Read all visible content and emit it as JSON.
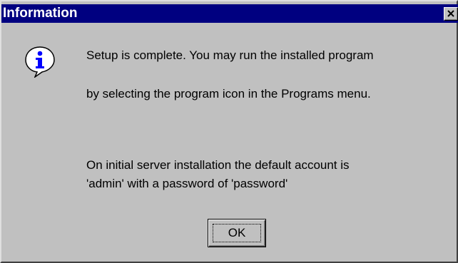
{
  "dialog": {
    "title": "Information",
    "close_glyph": "×",
    "icon": "information-icon",
    "messages": [
      "Setup is complete.  You may run the installed program",
      "by selecting the program icon in the Programs menu.",
      "On initial server installation the default account is",
      "'admin' with a password of 'password'"
    ],
    "ok_label": "OK"
  },
  "colors": {
    "titlebar": "#000080",
    "face": "#c0c0c0",
    "icon_blue": "#0000ff"
  }
}
